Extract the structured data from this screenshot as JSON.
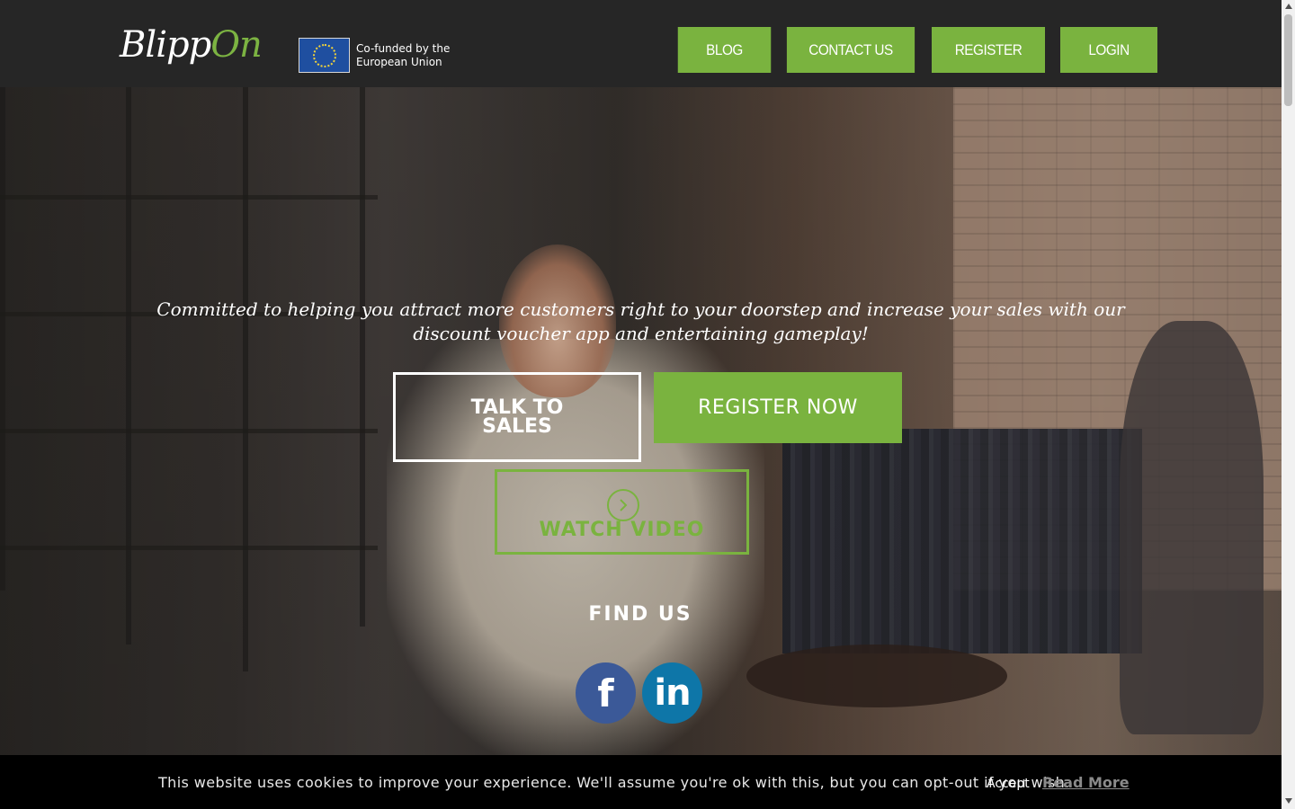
{
  "brand": {
    "logo_main": "Blipp",
    "logo_accent": "On",
    "eu_line1": "Co-funded by the",
    "eu_line2": "European Union"
  },
  "nav": {
    "items": [
      {
        "label": "BLOG"
      },
      {
        "label": "CONTACT US"
      },
      {
        "label": "REGISTER"
      },
      {
        "label": "LOGIN"
      }
    ]
  },
  "hero": {
    "tagline": "Committed to helping you attract more customers right to your doorstep and increase your sales with our discount voucher app and entertaining gameplay!",
    "talk_to_sales": "TALK TO SALES",
    "register_now": "REGISTER NOW",
    "watch_video": "WATCH VIDEO",
    "find_us": "FIND US",
    "facebook_glyph": "f",
    "linkedin_glyph": "in"
  },
  "cookie": {
    "message": "This website uses cookies to improve your experience. We'll assume you're ok with this, but you can opt-out if you wish.",
    "accept": "Accept",
    "read_more": "Read More"
  },
  "colors": {
    "accent_green": "#7ab33f",
    "header_bg": "#262626",
    "facebook_blue": "#3b5998",
    "linkedin_blue": "#0e76a8"
  }
}
